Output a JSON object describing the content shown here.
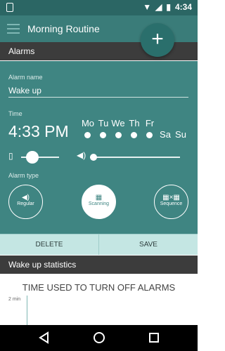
{
  "status": {
    "time": "4:34"
  },
  "toolbar": {
    "title": "Morning Routine",
    "fab_label": "+"
  },
  "alarms_header": "Alarms",
  "alarm": {
    "name_label": "Alarm name",
    "name_value": "Wake up",
    "time_label": "Time",
    "time_value": "4:33 PM",
    "days": [
      {
        "label": "Mo",
        "selected": true
      },
      {
        "label": "Tu",
        "selected": true
      },
      {
        "label": "We",
        "selected": true
      },
      {
        "label": "Th",
        "selected": true
      },
      {
        "label": "Fr",
        "selected": true
      },
      {
        "label": "Sa",
        "selected": false
      },
      {
        "label": "Su",
        "selected": false
      }
    ],
    "vibration_level": 0.2,
    "volume_level": 0.0,
    "type_label": "Alarm type",
    "types": [
      {
        "label": "Regular",
        "icon": "speaker-icon",
        "selected": false
      },
      {
        "label": "Scanning",
        "icon": "qr-code-icon",
        "selected": true
      },
      {
        "label": "Sequence",
        "icon": "qr-sequence-icon",
        "selected": false
      }
    ]
  },
  "actions": {
    "delete": "DELETE",
    "save": "SAVE"
  },
  "stats": {
    "header": "Wake up statistics",
    "chart_title": "TIME USED TO TURN OFF ALARMS",
    "y_tick": "2 min"
  },
  "colors": {
    "accent": "#3f8582",
    "toolbar": "#3a7c79",
    "statusbar": "#2b6664",
    "section_header": "#3c3c3c",
    "action_bar": "#c4e6e3"
  }
}
